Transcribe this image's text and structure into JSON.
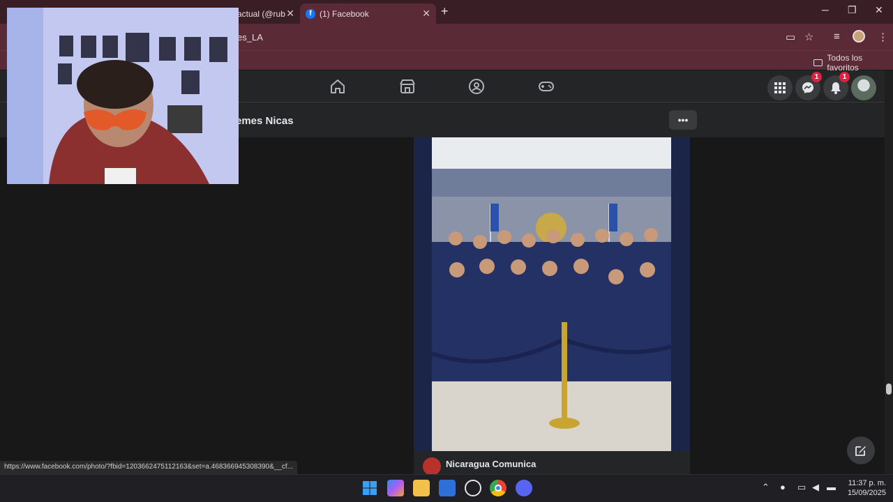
{
  "browser": {
    "tabs": [
      {
        "label": "actual (@rub",
        "active": false
      },
      {
        "label": "(1) Facebook",
        "active": true
      }
    ],
    "tab_favicon_letter": "f",
    "new_tab_symbol": "+",
    "close_symbol": "✕",
    "window_controls": {
      "minimize": "─",
      "maximize": "❐",
      "close": "✕"
    },
    "address_text": "es_LA",
    "bookmarks_folder_label": "Todos los favoritos",
    "status_url": "https://www.facebook.com/photo/?fbid=1203662475112163&set=a.468366945308390&__cf..."
  },
  "facebook": {
    "nav_icons": [
      "home-icon",
      "marketplace-icon",
      "groups-icon",
      "gaming-icon"
    ],
    "menu_icon": "grid-menu-icon",
    "messenger_badge": "1",
    "notifications_badge": "1",
    "group_name": "emes Nicas",
    "more_label": "•••",
    "post_author": "Nicaragua Comunica",
    "colors": {
      "header_bg": "#242526",
      "page_bg": "#181818",
      "badge": "#e41e3f",
      "photo_bg": "#1a2548"
    }
  },
  "taskbar": {
    "time": "11:37 p. m.",
    "date": "15/09/2025",
    "apps": [
      "windows-start-icon",
      "copilot-icon",
      "file-explorer-icon",
      "store-icon",
      "app-icon",
      "chrome-icon",
      "discord-icon"
    ],
    "tray_icons": [
      "chevron-up-icon",
      "microphone-icon",
      "network-icon",
      "volume-icon",
      "battery-icon"
    ]
  }
}
